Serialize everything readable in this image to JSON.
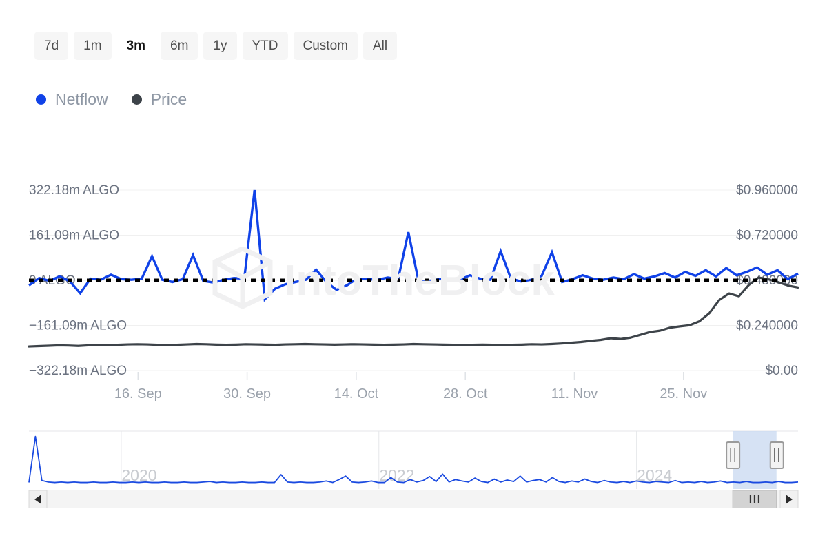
{
  "range_selector": {
    "buttons": [
      {
        "label": "7d",
        "selected": false
      },
      {
        "label": "1m",
        "selected": false
      },
      {
        "label": "3m",
        "selected": true
      },
      {
        "label": "6m",
        "selected": false
      },
      {
        "label": "1y",
        "selected": false
      },
      {
        "label": "YTD",
        "selected": false
      },
      {
        "label": "Custom",
        "selected": false
      },
      {
        "label": "All",
        "selected": false
      }
    ]
  },
  "legend": {
    "items": [
      {
        "label": "Netflow",
        "color": "#1042e8"
      },
      {
        "label": "Price",
        "color": "#3d4349"
      }
    ]
  },
  "watermark": {
    "text": "IntoTheBlock"
  },
  "navigator": {
    "years": [
      "2020",
      "2022",
      "2024"
    ],
    "scroll_left_label": "◂",
    "scroll_right_label": "▸",
    "selection_start_pct": 91.5,
    "selection_end_pct": 97.2
  },
  "chart_data": {
    "type": "line",
    "title": "",
    "xlabel": "",
    "ylabel": "Netflow",
    "y2label": "Price",
    "grid": true,
    "legend_position": "top-left",
    "x_tick_labels": [
      "16. Sep",
      "30. Sep",
      "14. Oct",
      "28. Oct",
      "11. Nov",
      "25. Nov"
    ],
    "y_left_tick_labels": [
      "322.18m ALGO",
      "161.09m ALGO",
      "0 ALGO",
      "−161.09m ALGO",
      "−322.18m ALGO"
    ],
    "y_left_tick_values": [
      322180000,
      161090000,
      0,
      -161090000,
      -322180000
    ],
    "y_right_tick_labels": [
      "$0.960000",
      "$0.720000",
      "$0.480000",
      "$0.240000",
      "$0.00"
    ],
    "y_right_tick_values": [
      0.96,
      0.72,
      0.48,
      0.24,
      0.0
    ],
    "ylim_left": [
      -322180000,
      322180000
    ],
    "ylim_right": [
      0.0,
      0.96
    ],
    "zero_line": true,
    "series": [
      {
        "name": "Netflow",
        "color": "#1042e8",
        "axis": "left",
        "unit": "ALGO",
        "values": [
          -18000000,
          8000000,
          -2000000,
          14000000,
          -4000000,
          -46000000,
          6000000,
          2000000,
          20000000,
          4000000,
          2000000,
          6000000,
          86000000,
          2000000,
          -6000000,
          4000000,
          90000000,
          -2000000,
          -8000000,
          2000000,
          8000000,
          6000000,
          322180000,
          -68000000,
          -30000000,
          -14000000,
          -6000000,
          2000000,
          38000000,
          -6000000,
          -34000000,
          -18000000,
          6000000,
          4000000,
          2000000,
          10000000,
          4000000,
          172000000,
          -4000000,
          -2000000,
          4000000,
          6000000,
          2000000,
          18000000,
          6000000,
          2000000,
          104000000,
          6000000,
          -4000000,
          2000000,
          16000000,
          100000000,
          -6000000,
          4000000,
          18000000,
          6000000,
          2000000,
          10000000,
          4000000,
          22000000,
          6000000,
          14000000,
          26000000,
          10000000,
          30000000,
          16000000,
          36000000,
          14000000,
          44000000,
          18000000,
          30000000,
          46000000,
          20000000,
          36000000,
          4000000,
          24000000
        ]
      },
      {
        "name": "Price",
        "color": "#3d4349",
        "axis": "right",
        "unit": "USD",
        "values": [
          0.128,
          0.13,
          0.132,
          0.134,
          0.133,
          0.131,
          0.134,
          0.136,
          0.135,
          0.137,
          0.139,
          0.14,
          0.139,
          0.137,
          0.136,
          0.137,
          0.139,
          0.141,
          0.14,
          0.138,
          0.137,
          0.138,
          0.14,
          0.139,
          0.138,
          0.137,
          0.139,
          0.14,
          0.141,
          0.14,
          0.139,
          0.138,
          0.139,
          0.14,
          0.139,
          0.138,
          0.137,
          0.138,
          0.139,
          0.141,
          0.14,
          0.139,
          0.138,
          0.137,
          0.136,
          0.137,
          0.138,
          0.137,
          0.136,
          0.137,
          0.138,
          0.14,
          0.139,
          0.141,
          0.144,
          0.148,
          0.152,
          0.158,
          0.163,
          0.172,
          0.168,
          0.175,
          0.19,
          0.205,
          0.212,
          0.228,
          0.235,
          0.241,
          0.262,
          0.305,
          0.375,
          0.41,
          0.395,
          0.455,
          0.495,
          0.485,
          0.47,
          0.452,
          0.442
        ]
      }
    ],
    "navigator_series": {
      "name": "Netflow (all time)",
      "color": "#1a4ae0",
      "values": [
        0.02,
        0.95,
        0.06,
        0.03,
        0.02,
        0.03,
        0.02,
        0.03,
        0.02,
        0.02,
        0.03,
        0.02,
        0.02,
        0.03,
        0.02,
        0.02,
        0.03,
        0.02,
        0.03,
        0.02,
        0.02,
        0.03,
        0.02,
        0.02,
        0.03,
        0.02,
        0.02,
        0.03,
        0.04,
        0.02,
        0.03,
        0.02,
        0.02,
        0.03,
        0.02,
        0.02,
        0.03,
        0.02,
        0.02,
        0.18,
        0.03,
        0.02,
        0.03,
        0.02,
        0.02,
        0.03,
        0.05,
        0.02,
        0.08,
        0.15,
        0.03,
        0.02,
        0.03,
        0.05,
        0.02,
        0.02,
        0.12,
        0.03,
        0.02,
        0.08,
        0.03,
        0.06,
        0.14,
        0.04,
        0.19,
        0.03,
        0.08,
        0.05,
        0.03,
        0.11,
        0.04,
        0.02,
        0.09,
        0.03,
        0.07,
        0.04,
        0.15,
        0.03,
        0.06,
        0.08,
        0.03,
        0.12,
        0.04,
        0.02,
        0.05,
        0.03,
        0.09,
        0.04,
        0.02,
        0.06,
        0.03,
        0.02,
        0.04,
        0.02,
        0.05,
        0.03,
        0.02,
        0.04,
        0.03,
        0.02,
        0.06,
        0.02,
        0.03,
        0.02,
        0.04,
        0.02,
        0.03,
        0.05,
        0.02,
        0.03,
        0.02,
        0.04,
        0.02,
        0.02,
        0.03,
        0.02,
        0.04,
        0.02,
        0.02,
        0.03
      ]
    }
  }
}
